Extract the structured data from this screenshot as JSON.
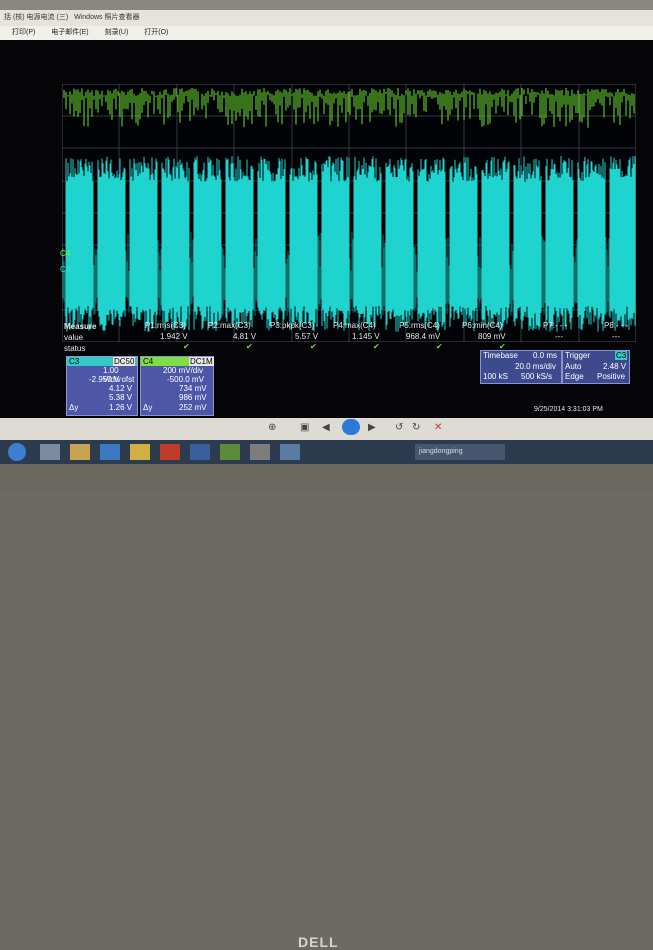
{
  "window": {
    "title": "Windows 照片查看器",
    "prefix": "括 (核)   电源电流 (三)"
  },
  "menu": {
    "print": "打印(P)",
    "email": "电子邮件(E)",
    "burn": "刻录(U)",
    "open": "打开(O)"
  },
  "channels": {
    "c4": "C4",
    "c3": "C3"
  },
  "measure": {
    "title": "Measure",
    "row_value": "value",
    "row_status": "status",
    "cols": [
      {
        "name": "P1:rms(C3)",
        "value": "1.942 V"
      },
      {
        "name": "P2:max(C3)",
        "value": "4.81 V"
      },
      {
        "name": "P3:pkpk(C3)",
        "value": "5.57 V"
      },
      {
        "name": "P4:max(C4)",
        "value": "1.145 V"
      },
      {
        "name": "P5:rms(C4)",
        "value": "968.4 mV"
      },
      {
        "name": "P6:min(C4)",
        "value": "809 mV"
      },
      {
        "name": "P7:- - -",
        "value": "---"
      },
      {
        "name": "P8:- - -",
        "value": "---"
      }
    ]
  },
  "c3_box": {
    "label": "C3",
    "coupling": "DC50",
    "lines": [
      "1.00 V/div",
      "-2.950 V ofst",
      "4.12 V",
      "5.38 V",
      "1.26 V"
    ],
    "prefix": "Δy"
  },
  "c4_box": {
    "label": "C4",
    "coupling": "DC1M",
    "lines": [
      "200 mV/div",
      "-500.0 mV",
      "734 mV",
      "986 mV",
      "252 mV"
    ],
    "prefix": "Δy"
  },
  "timebase": {
    "label": "Timebase",
    "delay": "0.0 ms",
    "div": "20.0 ms/div",
    "samples": "100 kS",
    "rate": "500 kS/s"
  },
  "trigger": {
    "label": "Trigger",
    "ch": "C3",
    "mode": "Auto",
    "level": "2.48 V",
    "type": "Edge",
    "slope": "Positive"
  },
  "datetime": "9/25/2014 3:31:03 PM",
  "taskbar": {
    "label": "jiangdongping"
  },
  "brand": "DELL"
}
